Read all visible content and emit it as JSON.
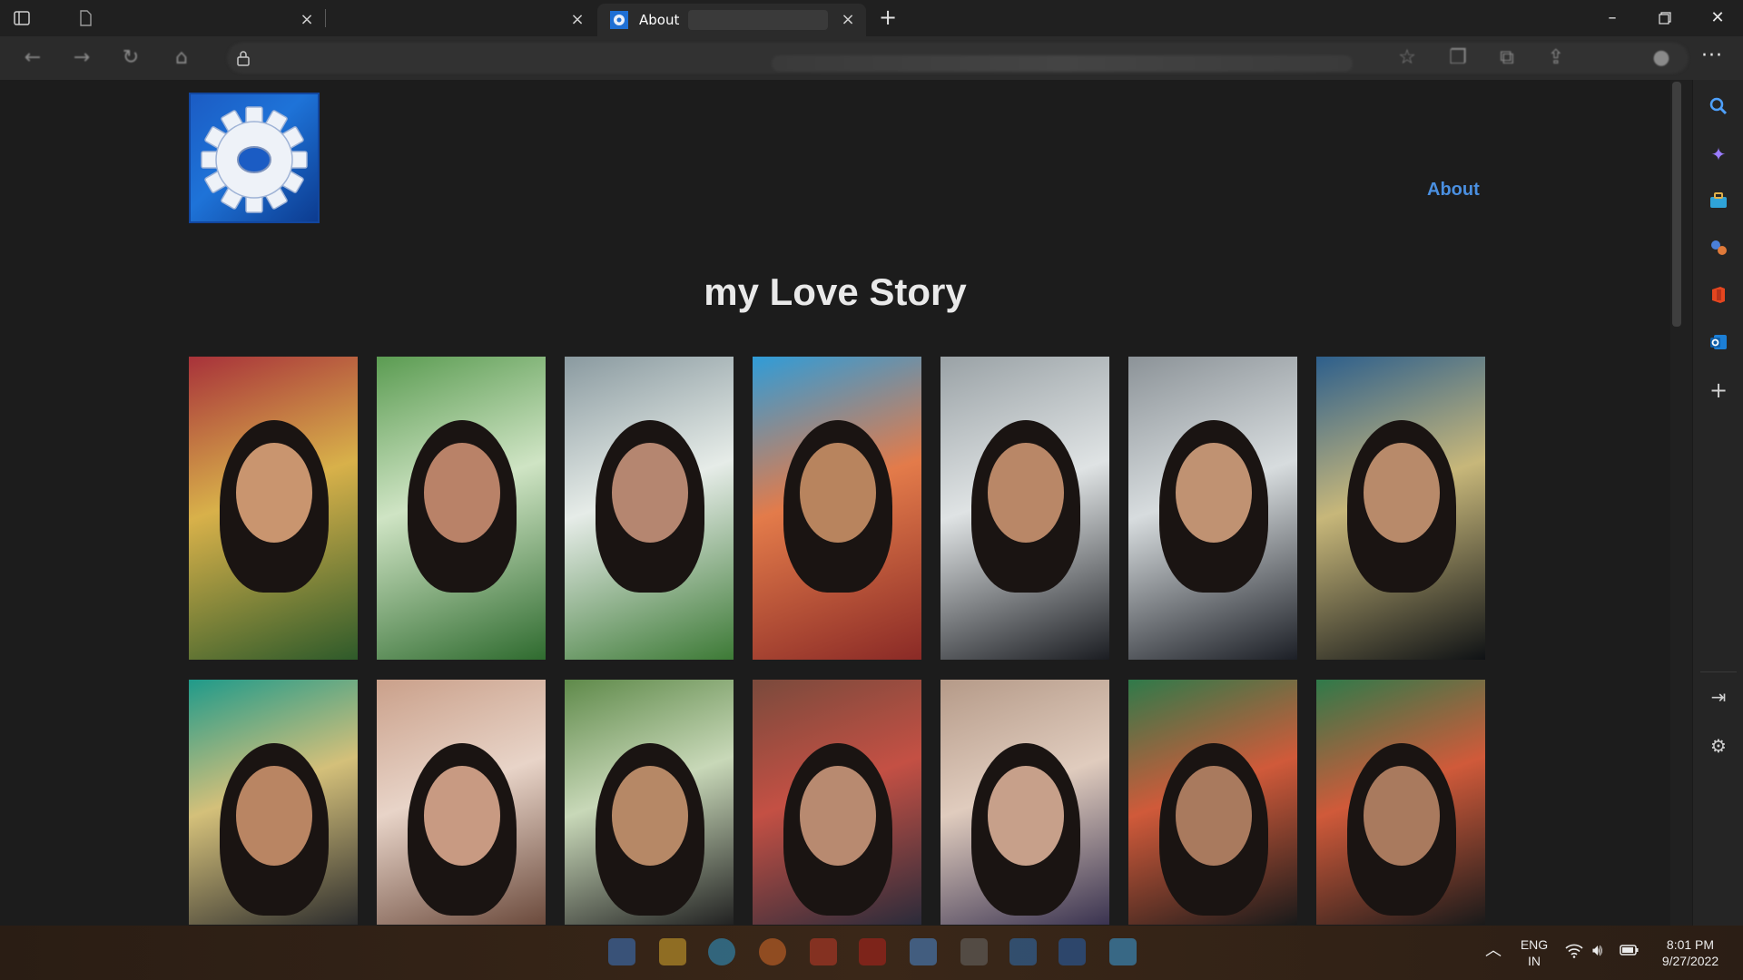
{
  "browser": {
    "tabs": [
      {
        "label": "",
        "active": false
      },
      {
        "label": "",
        "active": false
      },
      {
        "label": "About",
        "active": true
      }
    ],
    "new_tab_label": "+",
    "menu_label": "···"
  },
  "page": {
    "nav": {
      "about_label": "About"
    },
    "title": "my Love Story",
    "gallery_count": 14
  },
  "taskbar": {
    "lang_primary": "ENG",
    "lang_secondary": "IN",
    "time": "8:01 PM",
    "date": "9/27/2022"
  },
  "colors": {
    "page_bg": "#1c1c1c",
    "accent_link": "#4a8fe0",
    "logo_blue": "#1e73d8"
  }
}
